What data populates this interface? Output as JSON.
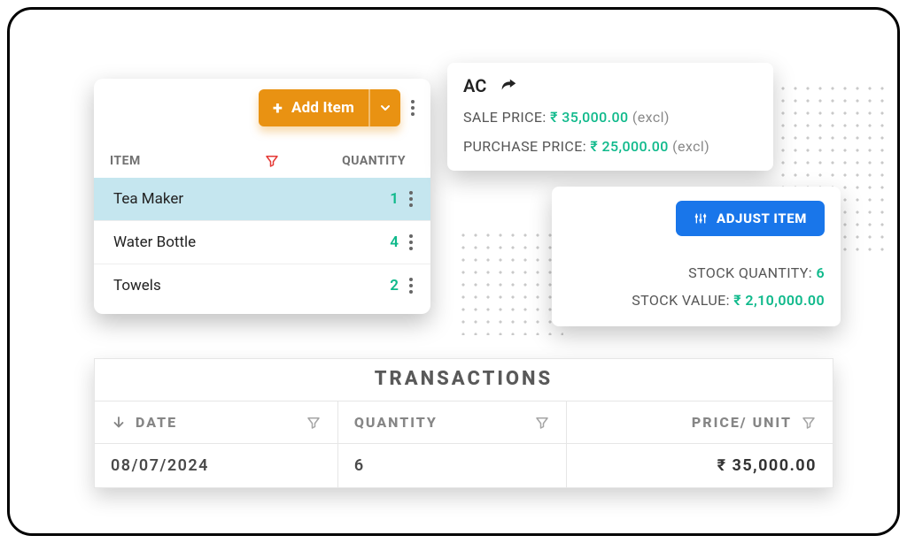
{
  "items_panel": {
    "add_button_label": "Add Item",
    "header_item": "ITEM",
    "header_quantity": "QUANTITY",
    "rows": [
      {
        "name": "Tea Maker",
        "qty": "1",
        "selected": true
      },
      {
        "name": "Water Bottle",
        "qty": "4",
        "selected": false
      },
      {
        "name": "Towels",
        "qty": "2",
        "selected": false
      }
    ]
  },
  "price_card": {
    "title": "AC",
    "sale_label": "SALE PRICE:",
    "sale_value": "₹ 35,000.00",
    "sale_suffix": "(excl)",
    "purchase_label": "PURCHASE PRICE:",
    "purchase_value": "₹ 25,000.00",
    "purchase_suffix": "(excl)"
  },
  "stock_card": {
    "adjust_label": "ADJUST ITEM",
    "qty_label": "STOCK QUANTITY:",
    "qty_value": "6",
    "val_label": "STOCK VALUE:",
    "val_value": "₹ 2,10,000.00"
  },
  "transactions": {
    "title": "TRANSACTIONS",
    "col_date": "DATE",
    "col_qty": "QUANTITY",
    "col_price": "PRICE/ UNIT",
    "rows": [
      {
        "date": "08/07/2024",
        "qty": "6",
        "price": "₹ 35,000.00"
      }
    ]
  }
}
